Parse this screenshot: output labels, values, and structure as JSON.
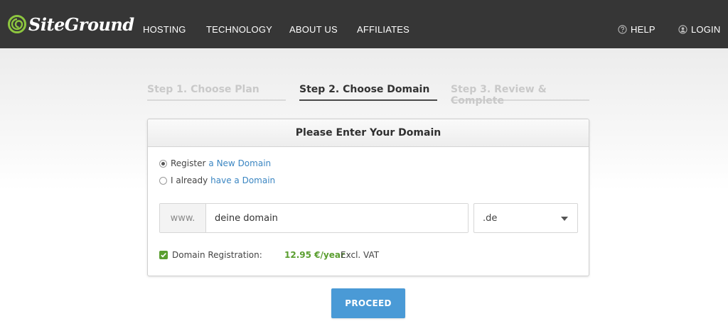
{
  "brand": {
    "name": "SiteGround",
    "accent": "#8dc63f"
  },
  "nav": {
    "items": [
      {
        "label": "HOSTING"
      },
      {
        "label": "TECHNOLOGY"
      },
      {
        "label": "ABOUT US"
      },
      {
        "label": "AFFILIATES"
      }
    ],
    "help": {
      "label": "HELP",
      "icon": "question-circle-icon"
    },
    "login": {
      "label": "LOGIN",
      "icon": "user-icon"
    }
  },
  "steps": [
    {
      "label": "Step 1. Choose Plan",
      "active": false
    },
    {
      "label": "Step 2. Choose Domain",
      "active": true
    },
    {
      "label": "Step 3. Review & Complete",
      "active": false
    }
  ],
  "card": {
    "title": "Please Enter Your Domain",
    "options": [
      {
        "prefix": "Register",
        "link": "a New Domain",
        "checked": true
      },
      {
        "prefix": "I already",
        "link": "have a Domain",
        "checked": false
      }
    ],
    "domain": {
      "prefix": "www.",
      "value": "deine domain"
    },
    "tld": {
      "selected": ".de"
    },
    "registration": {
      "label": "Domain Registration:",
      "price": "12.95 €/year",
      "tax": "Excl. VAT",
      "checked": true
    }
  },
  "colors": {
    "topbar": "#363636",
    "price": "#5a9e2f",
    "link": "#3b86c2",
    "button": "#4a9ad6"
  },
  "proceed_label": "PROCEED"
}
